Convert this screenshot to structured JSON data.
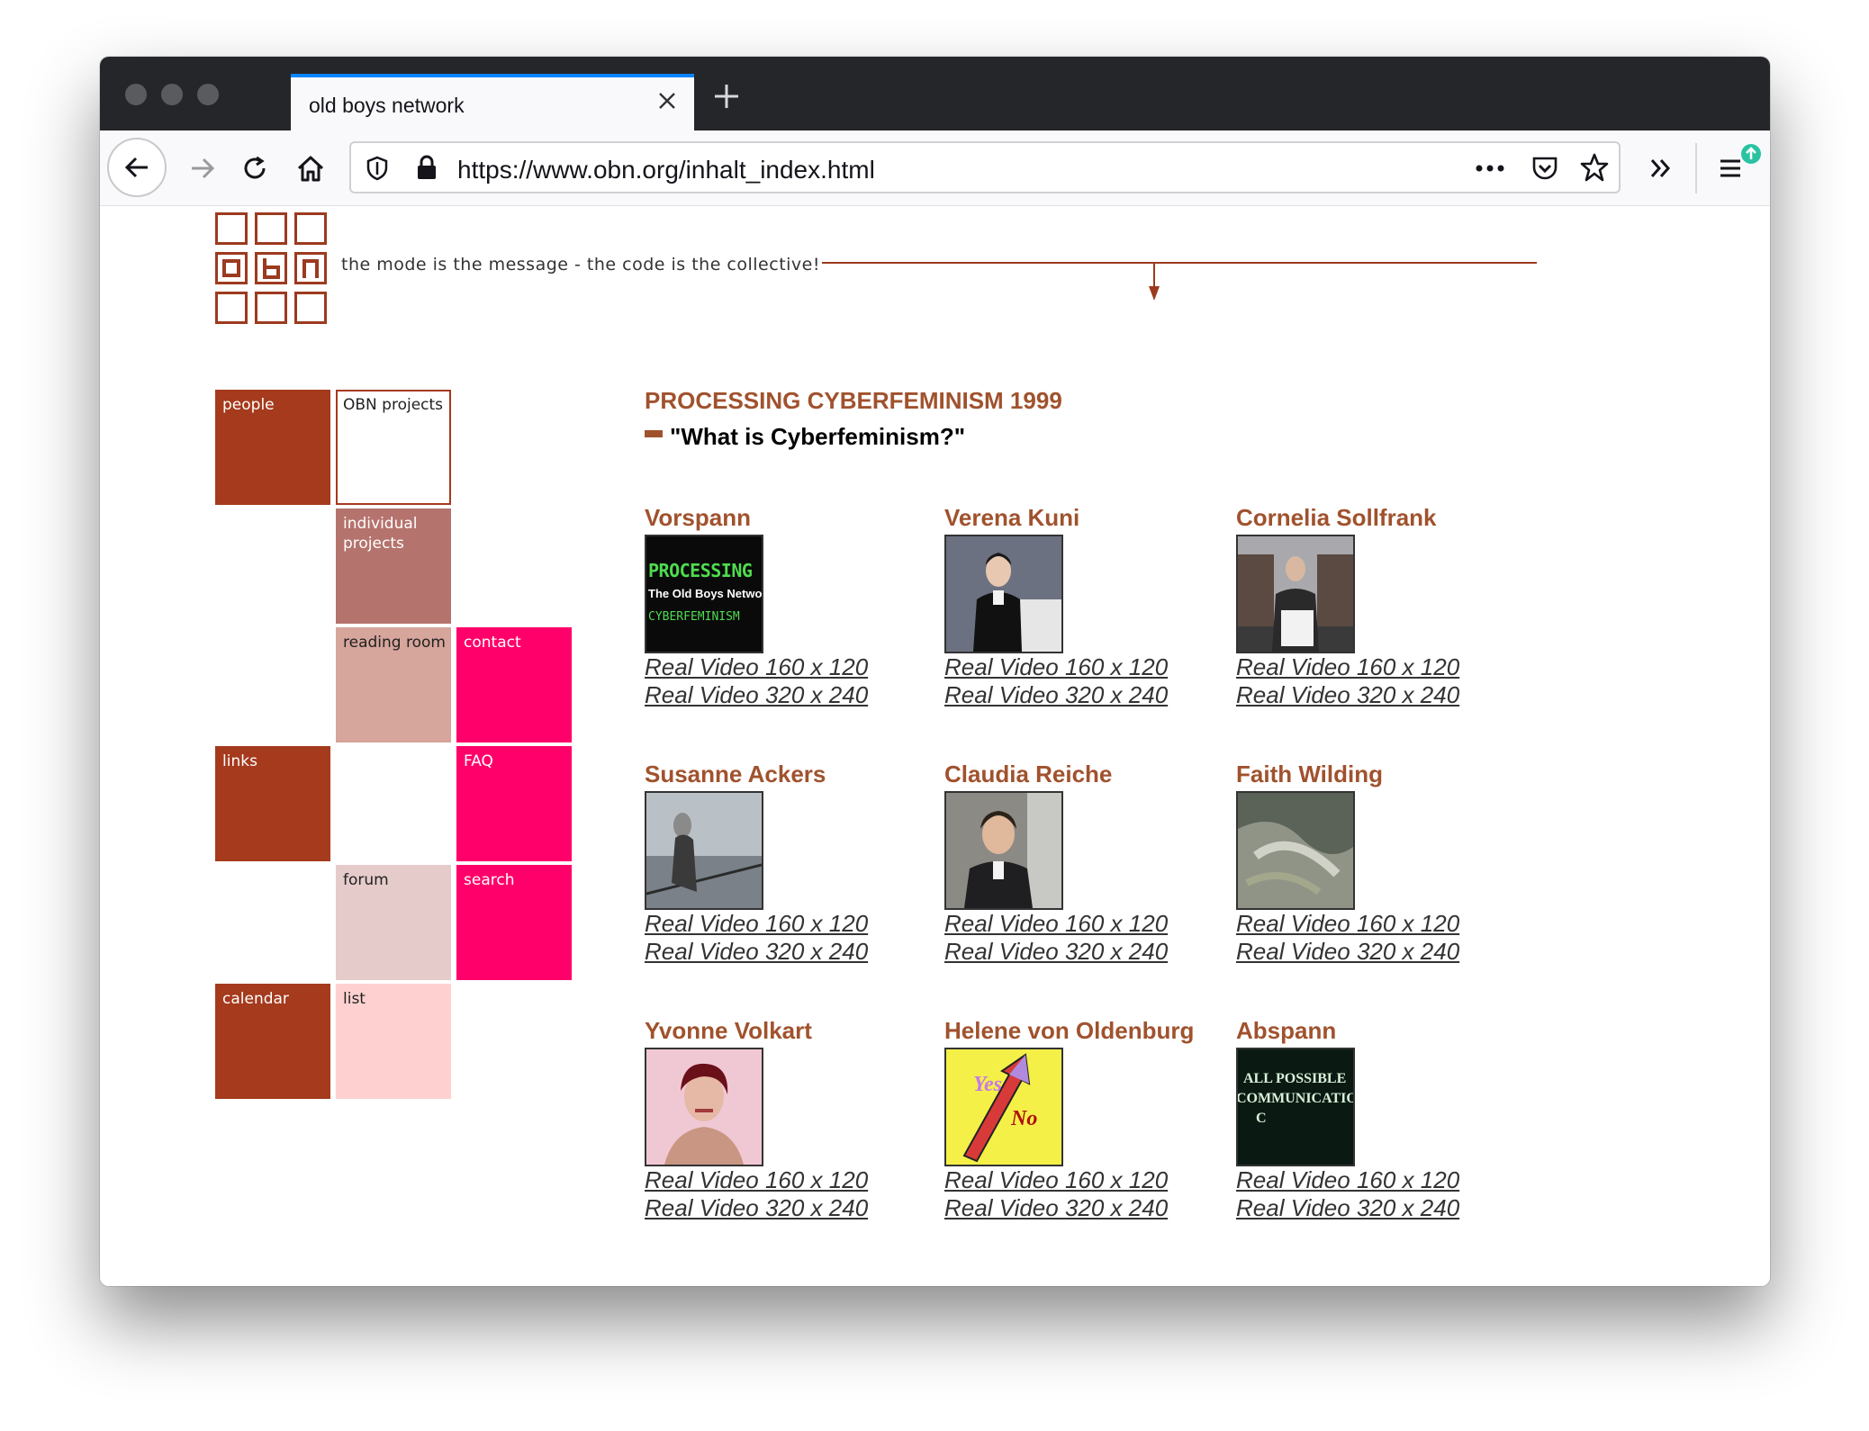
{
  "browser": {
    "tab_title": "old boys network",
    "url": "https://www.obn.org/inhalt_index.html"
  },
  "site": {
    "logo_letters": [
      "o",
      "B",
      "n"
    ],
    "tagline": "the mode is the message - the code is the collective!",
    "accent_color": "#a0522d"
  },
  "menu": {
    "people": "people",
    "obn_projects": "OBN projects",
    "individual_projects": "individual projects",
    "reading_room": "reading room",
    "contact": "contact",
    "links": "links",
    "faq": "FAQ",
    "forum": "forum",
    "search": "search",
    "calendar": "calendar",
    "list": "list"
  },
  "main": {
    "title": "PROCESSING CYBERFEMINISM 1999",
    "subtitle": "\"What is Cyberfeminism?\"",
    "entries": [
      {
        "name": "Vorspann",
        "link_small": "Real Video 160 x 120",
        "link_large": "Real Video 320 x 240",
        "thumb_text": [
          "PROCESSING",
          "The Old Boys Network",
          "CYBERFEMINISM"
        ]
      },
      {
        "name": "Verena Kuni",
        "link_small": "Real Video 160 x 120",
        "link_large": "Real Video 320 x 240"
      },
      {
        "name": "Cornelia Sollfrank",
        "link_small": "Real Video 160 x 120",
        "link_large": "Real Video 320 x 240"
      },
      {
        "name": "Susanne Ackers",
        "link_small": "Real Video 160 x 120",
        "link_large": "Real Video 320 x 240"
      },
      {
        "name": "Claudia Reiche",
        "link_small": "Real Video 160 x 120",
        "link_large": "Real Video 320 x 240"
      },
      {
        "name": "Faith Wilding",
        "link_small": "Real Video 160 x 120",
        "link_large": "Real Video 320 x 240"
      },
      {
        "name": "Yvonne Volkart",
        "link_small": "Real Video 160 x 120",
        "link_large": "Real Video 320 x 240"
      },
      {
        "name": "Helene von Oldenburg",
        "link_small": "Real Video 160 x 120",
        "link_large": "Real Video 320 x 240",
        "thumb_text": [
          "Yes",
          "No"
        ]
      },
      {
        "name": "Abspann",
        "link_small": "Real Video 160 x 120",
        "link_large": "Real Video 320 x 240",
        "thumb_text": [
          "ALL POSSIBLE",
          "COMMUNICATIO",
          "C"
        ]
      }
    ]
  }
}
